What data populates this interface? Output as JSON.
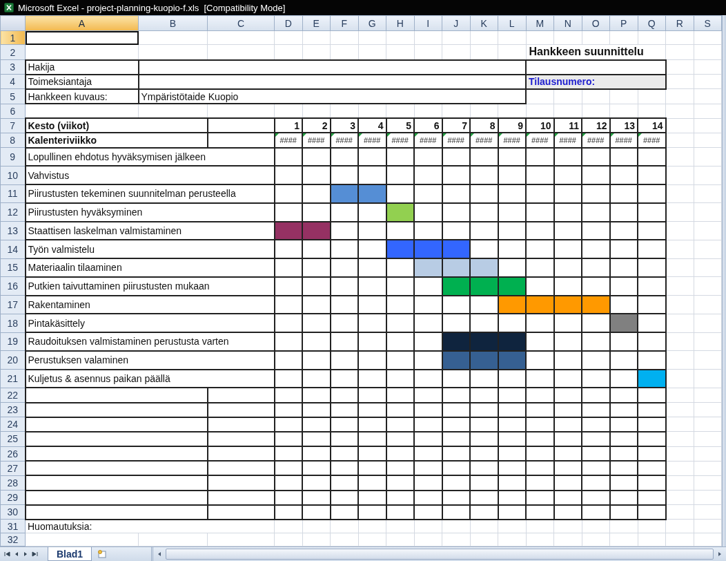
{
  "window": {
    "title": "Microsoft Excel - project-planning-kuopio-f.xls  [Compatibility Mode]"
  },
  "column_headers": [
    {
      "label": "A",
      "selected": true
    },
    {
      "label": "B",
      "selected": false
    },
    {
      "label": "C",
      "selected": false
    },
    {
      "label": "D",
      "selected": false
    },
    {
      "label": "E",
      "selected": false
    },
    {
      "label": "F",
      "selected": false
    },
    {
      "label": "G",
      "selected": false
    },
    {
      "label": "H",
      "selected": false
    },
    {
      "label": "I",
      "selected": false
    },
    {
      "label": "J",
      "selected": false
    },
    {
      "label": "K",
      "selected": false
    },
    {
      "label": "L",
      "selected": false
    },
    {
      "label": "M",
      "selected": false
    },
    {
      "label": "N",
      "selected": false
    },
    {
      "label": "O",
      "selected": false
    },
    {
      "label": "P",
      "selected": false
    },
    {
      "label": "Q",
      "selected": false
    },
    {
      "label": "R",
      "selected": false
    },
    {
      "label": "S",
      "selected": false
    }
  ],
  "row_headers": [
    {
      "label": "1",
      "selected": true
    },
    {
      "label": "2",
      "selected": false
    },
    {
      "label": "3",
      "selected": false
    },
    {
      "label": "4",
      "selected": false
    },
    {
      "label": "5",
      "selected": false
    },
    {
      "label": "6",
      "selected": false
    },
    {
      "label": "7",
      "selected": false
    },
    {
      "label": "8",
      "selected": false
    },
    {
      "label": "9",
      "selected": false
    },
    {
      "label": "10",
      "selected": false
    },
    {
      "label": "11",
      "selected": false
    },
    {
      "label": "12",
      "selected": false
    },
    {
      "label": "13",
      "selected": false
    },
    {
      "label": "14",
      "selected": false
    },
    {
      "label": "15",
      "selected": false
    },
    {
      "label": "16",
      "selected": false
    },
    {
      "label": "17",
      "selected": false
    },
    {
      "label": "18",
      "selected": false
    },
    {
      "label": "19",
      "selected": false
    },
    {
      "label": "20",
      "selected": false
    },
    {
      "label": "21",
      "selected": false
    },
    {
      "label": "22",
      "selected": false
    },
    {
      "label": "23",
      "selected": false
    },
    {
      "label": "24",
      "selected": false
    },
    {
      "label": "25",
      "selected": false
    },
    {
      "label": "26",
      "selected": false
    },
    {
      "label": "27",
      "selected": false
    },
    {
      "label": "28",
      "selected": false
    },
    {
      "label": "29",
      "selected": false
    },
    {
      "label": "30",
      "selected": false
    },
    {
      "label": "31",
      "selected": false
    },
    {
      "label": "32",
      "selected": false
    }
  ],
  "form": {
    "title": "Hankkeen suunnittelu",
    "applicant_label": "Hakija",
    "client_label": "Toimeksiantaja",
    "order_number_label": "Tilausnumero:",
    "description_label": "Hankkeen kuvaus:",
    "description_value": "Ympäristötaide Kuopio"
  },
  "schedule": {
    "duration_label": "Kesto (viikot)",
    "calendar_week_label": "Kalenteriviikko",
    "weeks": [
      {
        "number": "1",
        "calendar_week": "####"
      },
      {
        "number": "2",
        "calendar_week": "####"
      },
      {
        "number": "3",
        "calendar_week": "####"
      },
      {
        "number": "4",
        "calendar_week": "####"
      },
      {
        "number": "5",
        "calendar_week": "####"
      },
      {
        "number": "6",
        "calendar_week": "####"
      },
      {
        "number": "7",
        "calendar_week": "####"
      },
      {
        "number": "8",
        "calendar_week": "####"
      },
      {
        "number": "9",
        "calendar_week": "####"
      },
      {
        "number": "10",
        "calendar_week": "####"
      },
      {
        "number": "11",
        "calendar_week": "####"
      },
      {
        "number": "12",
        "calendar_week": "####"
      },
      {
        "number": "13",
        "calendar_week": "####"
      },
      {
        "number": "14",
        "calendar_week": "####"
      }
    ],
    "tasks": [
      {
        "label": "Lopullinen ehdotus hyväksymisen jälkeen",
        "filled": [
          false,
          false,
          false,
          false,
          false,
          false,
          false,
          false,
          false,
          false,
          false,
          false,
          false,
          false
        ]
      },
      {
        "label": "Vahvistus",
        "filled": [
          false,
          false,
          false,
          false,
          false,
          false,
          false,
          false,
          false,
          false,
          false,
          false,
          false,
          false
        ]
      },
      {
        "label": "Piirustusten tekeminen suunnitelman perusteella",
        "color": "#558ed5",
        "filled": [
          false,
          false,
          true,
          true,
          false,
          false,
          false,
          false,
          false,
          false,
          false,
          false,
          false,
          false
        ]
      },
      {
        "label": "Piirustusten hyväksyminen",
        "color": "#92d050",
        "filled": [
          false,
          false,
          false,
          false,
          true,
          false,
          false,
          false,
          false,
          false,
          false,
          false,
          false,
          false
        ]
      },
      {
        "label": "Staattisen laskelman valmistaminen",
        "color": "#953163",
        "filled": [
          true,
          true,
          false,
          false,
          false,
          false,
          false,
          false,
          false,
          false,
          false,
          false,
          false,
          false
        ]
      },
      {
        "label": "Työn valmistelu",
        "color": "#3366ff",
        "filled": [
          false,
          false,
          false,
          false,
          true,
          true,
          true,
          false,
          false,
          false,
          false,
          false,
          false,
          false
        ]
      },
      {
        "label": "Materiaalin tilaaminen",
        "color": "#b8cce4",
        "filled": [
          false,
          false,
          false,
          false,
          false,
          true,
          true,
          true,
          false,
          false,
          false,
          false,
          false,
          false
        ]
      },
      {
        "label": "Putkien taivuttaminen piirustusten mukaan",
        "color": "#00b050",
        "filled": [
          false,
          false,
          false,
          false,
          false,
          false,
          true,
          true,
          true,
          false,
          false,
          false,
          false,
          false
        ]
      },
      {
        "label": "Rakentaminen",
        "color": "#ff9900",
        "filled": [
          false,
          false,
          false,
          false,
          false,
          false,
          false,
          false,
          true,
          true,
          true,
          true,
          false,
          false
        ]
      },
      {
        "label": "Pintakäsittely",
        "color": "#808080",
        "filled": [
          false,
          false,
          false,
          false,
          false,
          false,
          false,
          false,
          false,
          false,
          false,
          false,
          true,
          false
        ]
      },
      {
        "label": "Raudoituksen valmistaminen perustusta varten",
        "color": "#0f243e",
        "filled": [
          false,
          false,
          false,
          false,
          false,
          false,
          true,
          true,
          true,
          false,
          false,
          false,
          false,
          false
        ]
      },
      {
        "label": "Perustuksen valaminen",
        "color": "#366092",
        "filled": [
          false,
          false,
          false,
          false,
          false,
          false,
          true,
          true,
          true,
          false,
          false,
          false,
          false,
          false
        ]
      },
      {
        "label": "Kuljetus & asennus paikan päällä",
        "color": "#00b0f0",
        "filled": [
          false,
          false,
          false,
          false,
          false,
          false,
          false,
          false,
          false,
          false,
          false,
          false,
          false,
          true
        ]
      }
    ]
  },
  "notes_label": "Huomautuksia:",
  "sheet_tabs": [
    {
      "label": "Blad1",
      "selected": true
    }
  ]
}
